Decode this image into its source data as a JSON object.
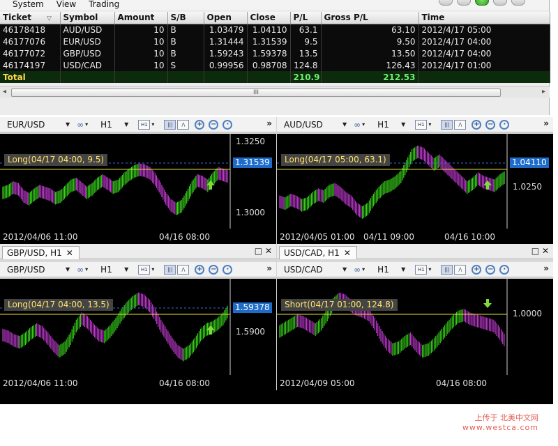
{
  "menu": [
    "System",
    "View",
    "Trading"
  ],
  "orders": {
    "columns": [
      "Ticket",
      "Symbol",
      "Amount",
      "S/B",
      "Open",
      "Close",
      "P/L",
      "Gross P/L",
      "Time"
    ],
    "sort_glyph": "▽",
    "rows": [
      [
        "46178418",
        "AUD/USD",
        "10",
        "B",
        "1.03479",
        "1.04110",
        "63.1",
        "63.10",
        "2012/4/17 05:00"
      ],
      [
        "46177076",
        "EUR/USD",
        "10",
        "B",
        "1.31444",
        "1.31539",
        "9.5",
        "9.50",
        "2012/4/17 04:00"
      ],
      [
        "46177072",
        "GBP/USD",
        "10",
        "B",
        "1.59243",
        "1.59378",
        "13.5",
        "13.50",
        "2012/4/17 04:00"
      ],
      [
        "46174197",
        "USD/CAD",
        "10",
        "S",
        "0.99956",
        "0.98708",
        "124.8",
        "126.43",
        "2012/4/17 01:00"
      ]
    ],
    "total": {
      "label": "Total",
      "pl": "210.9",
      "gross": "212.53"
    },
    "scroll_thumb": "III"
  },
  "toolbar_common": {
    "timeframe": "H1",
    "more": "»"
  },
  "panes": [
    {
      "symbol": "EUR/USD",
      "tab": "",
      "prices": [
        "1.3250",
        "1.3000"
      ],
      "current": "1.31539",
      "position": "Long(04/17 04:00, 9.5)",
      "times": [
        "2012/04/06 11:00",
        "04/16 08:00"
      ],
      "arrow": "up",
      "series": [
        0.4,
        0.42,
        0.46,
        0.44,
        0.36,
        0.33,
        0.38,
        0.42,
        0.4,
        0.38,
        0.34,
        0.36,
        0.42,
        0.48,
        0.5,
        0.45,
        0.4,
        0.44,
        0.5,
        0.54,
        0.5,
        0.46,
        0.48,
        0.55,
        0.6,
        0.64,
        0.66,
        0.65,
        0.62,
        0.55,
        0.45,
        0.34,
        0.26,
        0.22,
        0.25,
        0.35,
        0.46,
        0.54,
        0.52,
        0.48,
        0.56,
        0.62,
        0.6,
        0.58
      ]
    },
    {
      "symbol": "AUD/USD",
      "tab": "",
      "prices": [
        "1.0250"
      ],
      "current": "1.04110",
      "position": "Long(04/17 05:00, 63.1)",
      "times": [
        "2012/04/05 01:00",
        "04/11 09:00",
        "04/16 10:00"
      ],
      "arrow": "up",
      "series": [
        0.3,
        0.28,
        0.32,
        0.3,
        0.26,
        0.28,
        0.34,
        0.38,
        0.36,
        0.42,
        0.44,
        0.4,
        0.34,
        0.3,
        0.22,
        0.18,
        0.22,
        0.32,
        0.4,
        0.46,
        0.48,
        0.52,
        0.58,
        0.7,
        0.82,
        0.86,
        0.84,
        0.78,
        0.72,
        0.76,
        0.7,
        0.64,
        0.58,
        0.52,
        0.46,
        0.5,
        0.56,
        0.52,
        0.5,
        0.48,
        0.54,
        0.58
      ]
    },
    {
      "symbol": "GBP/USD",
      "tab": "GBP/USD, H1",
      "prices": [
        "1.5900"
      ],
      "current": "1.59378",
      "position": "Long(04/17 04:00, 13.5)",
      "times": [
        "2012/04/06 11:00",
        "04/16 08:00"
      ],
      "arrow": "up",
      "series": [
        0.44,
        0.42,
        0.38,
        0.36,
        0.4,
        0.46,
        0.5,
        0.47,
        0.4,
        0.32,
        0.26,
        0.3,
        0.4,
        0.54,
        0.62,
        0.58,
        0.5,
        0.44,
        0.42,
        0.48,
        0.56,
        0.66,
        0.74,
        0.8,
        0.84,
        0.82,
        0.76,
        0.66,
        0.54,
        0.44,
        0.34,
        0.26,
        0.22,
        0.26,
        0.34,
        0.44,
        0.5,
        0.52,
        0.56,
        0.62,
        0.72
      ]
    },
    {
      "symbol": "USD/CAD",
      "tab": "USD/CAD, H1",
      "prices": [
        "1.0000"
      ],
      "current": "",
      "position": "Short(04/17 01:00, 124.8)",
      "times": [
        "2012/04/09 05:00",
        "04/16 08:00"
      ],
      "arrow": "down",
      "series": [
        0.48,
        0.52,
        0.56,
        0.6,
        0.58,
        0.54,
        0.5,
        0.56,
        0.66,
        0.78,
        0.84,
        0.82,
        0.76,
        0.72,
        0.7,
        0.66,
        0.56,
        0.44,
        0.34,
        0.28,
        0.3,
        0.36,
        0.4,
        0.32,
        0.26,
        0.28,
        0.34,
        0.42,
        0.5,
        0.58,
        0.64,
        0.66,
        0.62,
        0.6,
        0.58,
        0.56,
        0.54,
        0.46,
        0.36
      ]
    }
  ],
  "watermark": [
    "上传于  北美中文网",
    "www.westca.com"
  ]
}
